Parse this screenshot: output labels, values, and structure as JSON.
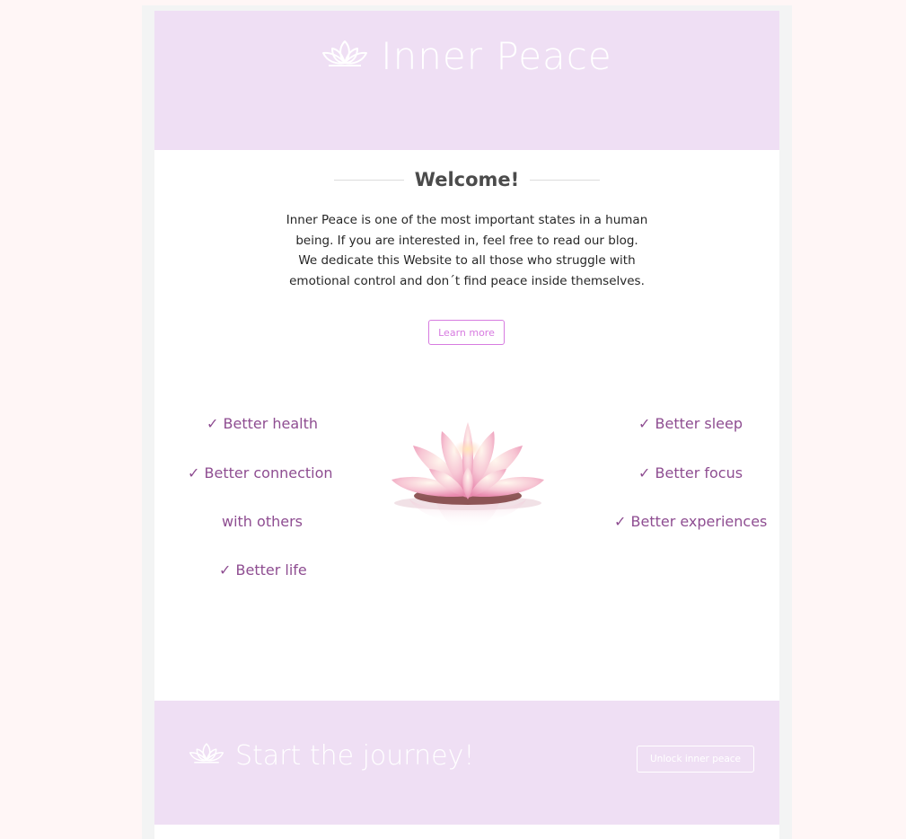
{
  "header": {
    "title": "Inner Peace",
    "icon": "lotus-icon"
  },
  "welcome": {
    "heading": "Welcome!",
    "text": "Inner Peace is one of the most important states in a human being. If you are interested in, feel free to read our blog. We dedicate this Website to all those who struggle with emotional control and don´t find peace inside themselves.",
    "button_label": "Learn more"
  },
  "benefits": {
    "left": [
      "✓ Better health",
      "✓ Better connection",
      "with others",
      "✓ Better life"
    ],
    "right": [
      "✓ Better sleep",
      "✓ Better focus",
      "✓ Better experiences"
    ]
  },
  "footer": {
    "title": "Start the journey!",
    "icon": "lotus-icon",
    "button_label": "Unlock inner peace"
  },
  "colors": {
    "page_bg": "#fff6f6",
    "header_bg": "#efdff4",
    "accent": "#d77be0",
    "benefit_text": "#8e4d91"
  }
}
